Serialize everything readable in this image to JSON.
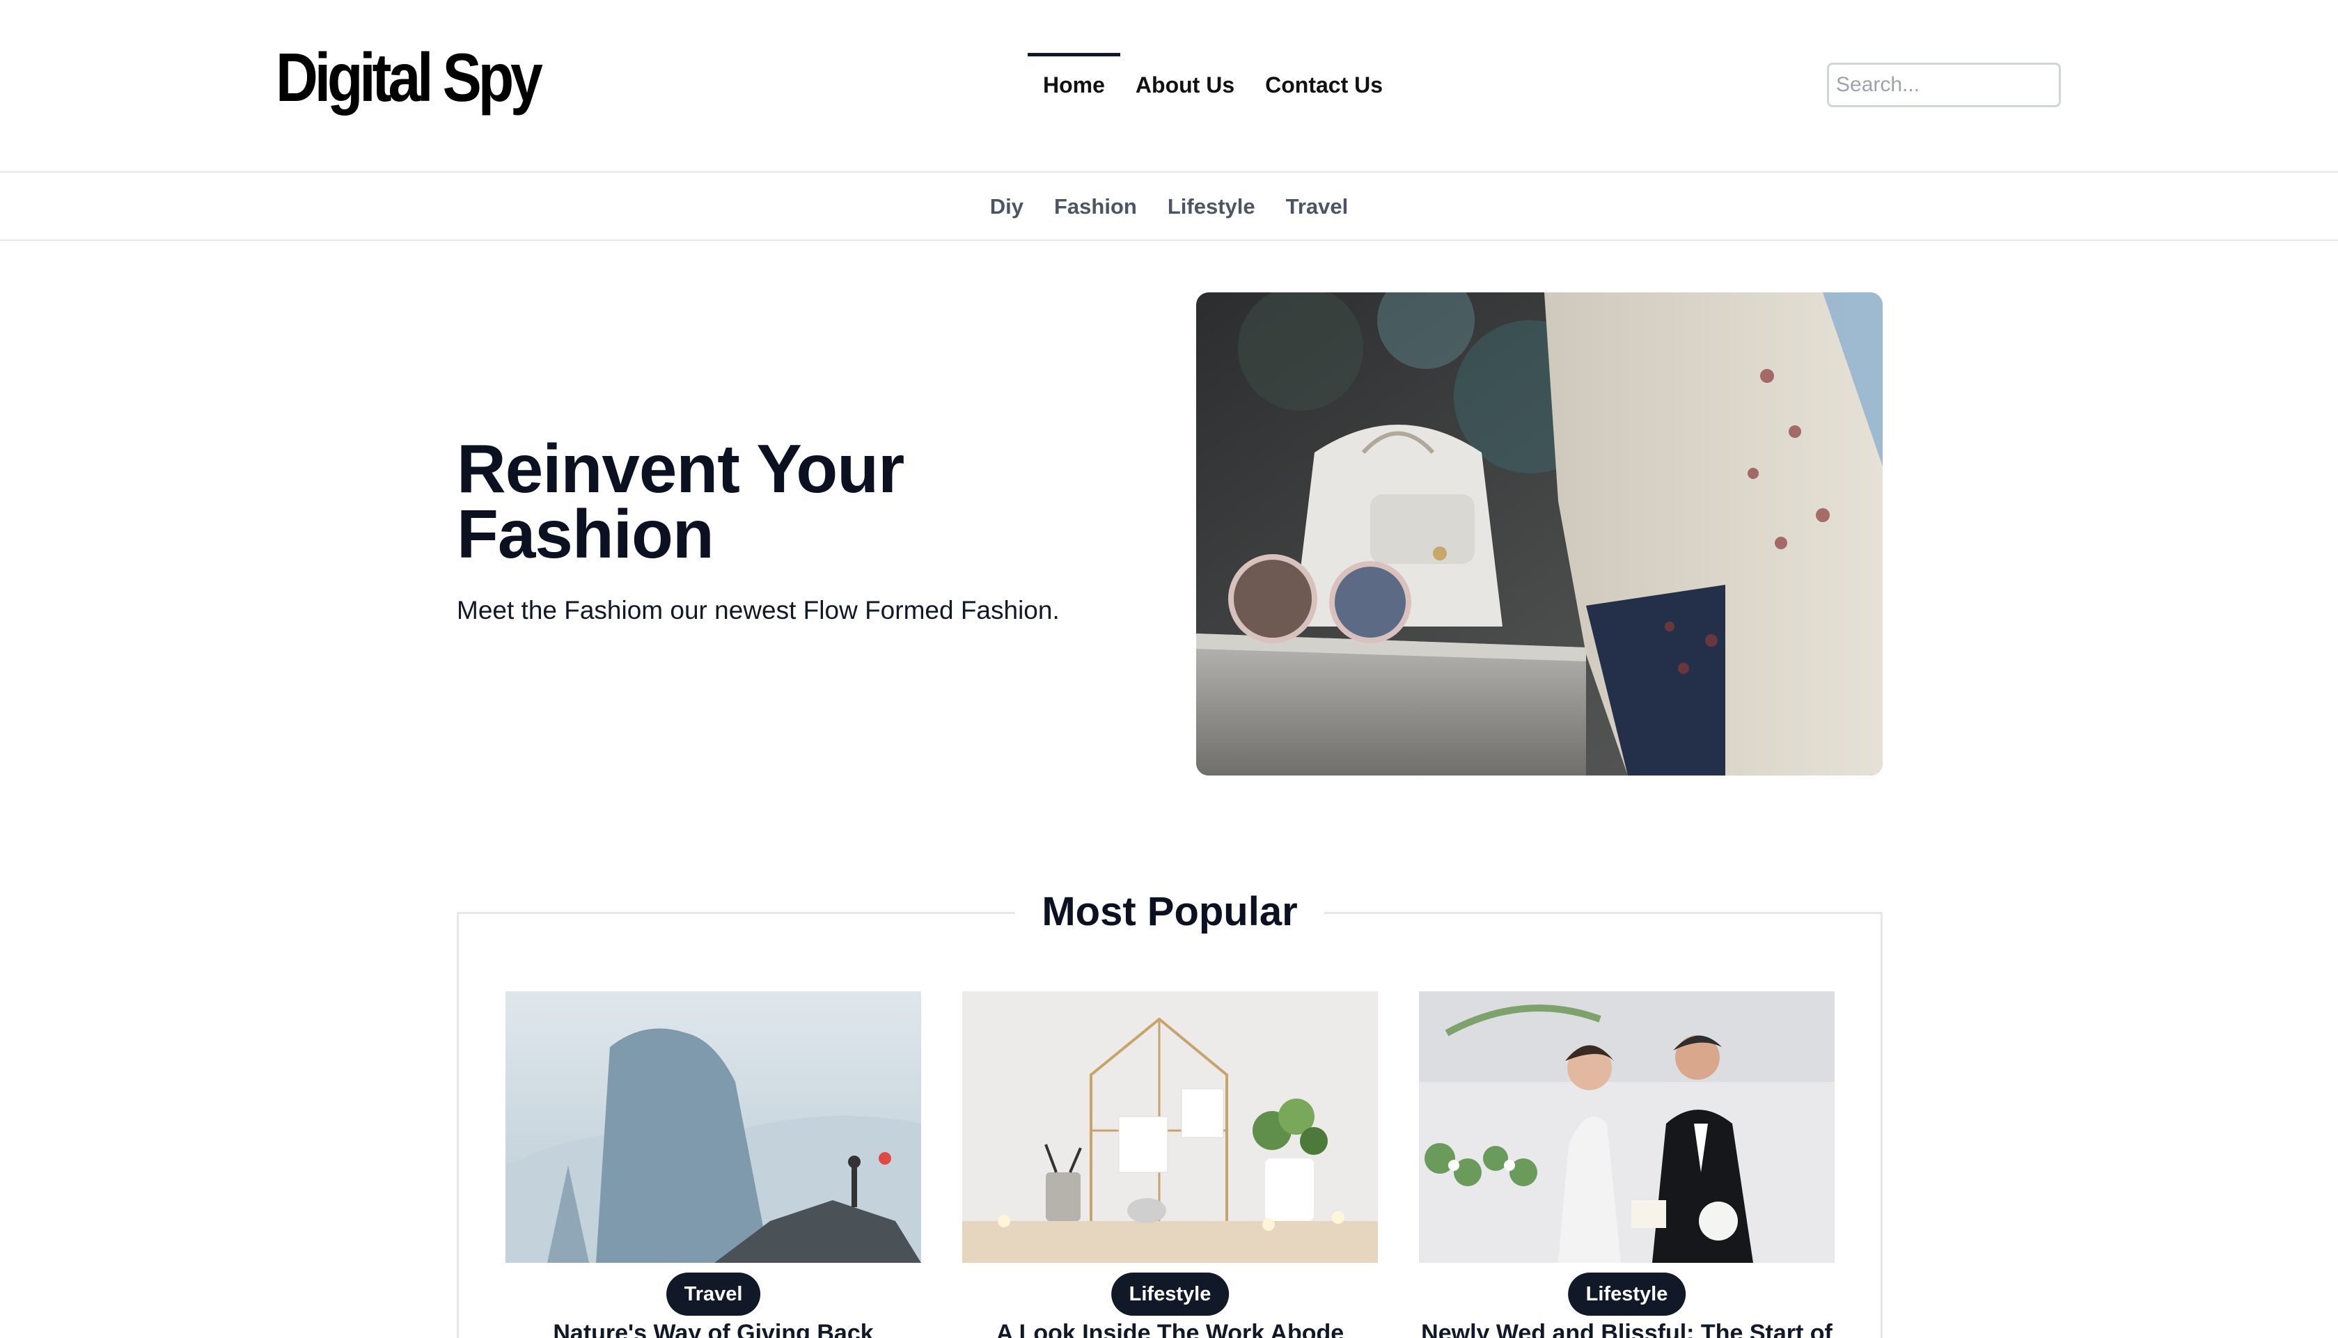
{
  "header": {
    "logo_text": "Digital Spy",
    "nav": [
      {
        "label": "Home"
      },
      {
        "label": "About Us"
      },
      {
        "label": "Contact Us"
      }
    ],
    "search_placeholder": "Search..."
  },
  "categories": [
    "Diy",
    "Fashion",
    "Lifestyle",
    "Travel"
  ],
  "hero": {
    "title": "Reinvent Your Fashion",
    "subtitle": "Meet the Fashiom our newest Flow Formed Fashion."
  },
  "popular": {
    "heading": "Most Popular",
    "cards": [
      {
        "category": "Travel",
        "title": "Nature's Way of Giving Back"
      },
      {
        "category": "Lifestyle",
        "title": "A Look Inside The Work Abode"
      },
      {
        "category": "Lifestyle",
        "title": "Newly Wed and Blissful: The Start of"
      }
    ]
  },
  "colors": {
    "primary_dark": "#111827",
    "muted_text": "#4b5563",
    "border": "#e5e7eb"
  }
}
